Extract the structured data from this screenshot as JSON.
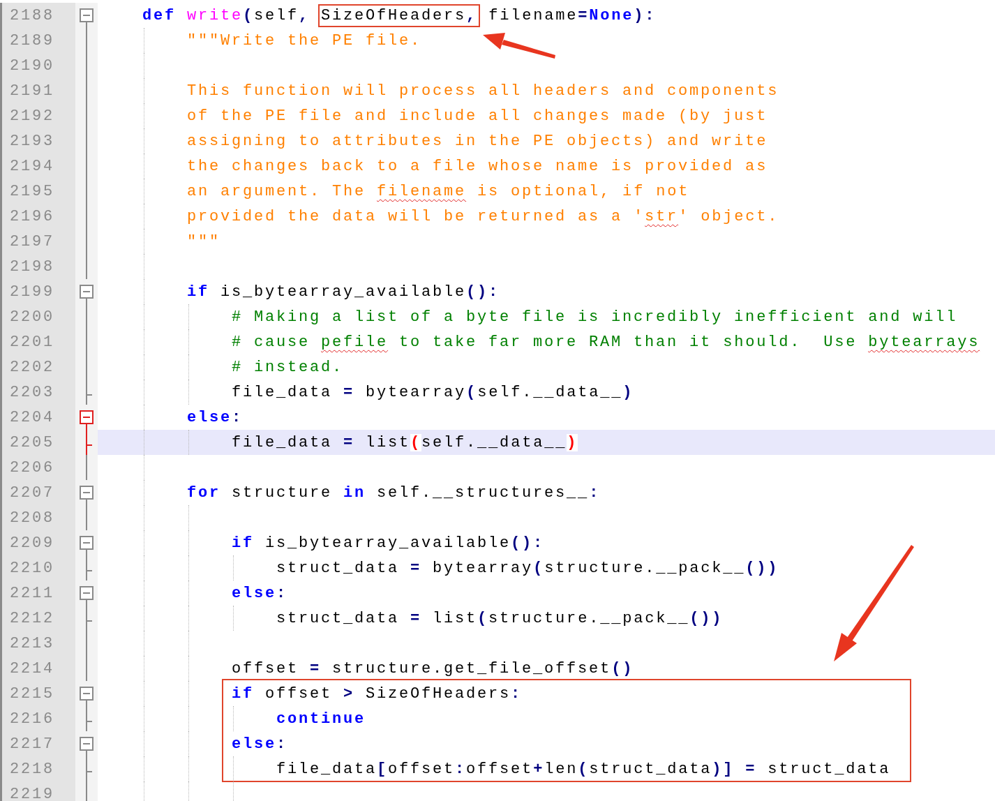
{
  "lines": [
    {
      "number": "2188",
      "kind": "open",
      "active": false,
      "current": false,
      "boxed": false,
      "tokens": [
        {
          "text": "    def",
          "kind": "kw"
        },
        {
          "text": " write",
          "kind": "fn"
        },
        {
          "text": "(",
          "kind": "op"
        },
        {
          "text": "self",
          "kind": "plain"
        },
        {
          "text": ", ",
          "kind": "op"
        },
        {
          "text": "SizeOfHeaders",
          "kind": "plain",
          "boxed": true
        },
        {
          "text": ",",
          "kind": "op",
          "boxed": true
        },
        {
          "text": " filename",
          "kind": "plain"
        },
        {
          "text": "=",
          "kind": "op"
        },
        {
          "text": "None",
          "kind": "kw"
        },
        {
          "text": ")",
          "kind": "op"
        },
        {
          "text": ":",
          "kind": "op"
        }
      ]
    },
    {
      "number": "2189",
      "kind": "line",
      "active": false,
      "current": false,
      "boxed": false,
      "tokens": [
        {
          "text": "        \"\"\"Write the PE file.",
          "kind": "doc"
        }
      ]
    },
    {
      "number": "2190",
      "kind": "line",
      "active": false,
      "current": false,
      "boxed": false
    },
    {
      "number": "2191",
      "kind": "line",
      "active": false,
      "current": false,
      "boxed": false,
      "tokens": [
        {
          "text": "        This function will process all headers and components",
          "kind": "doc"
        }
      ]
    },
    {
      "number": "2192",
      "kind": "line",
      "active": false,
      "current": false,
      "boxed": false,
      "tokens": [
        {
          "text": "        of the PE file and include all changes made (by just",
          "kind": "doc"
        }
      ]
    },
    {
      "number": "2193",
      "kind": "line",
      "active": false,
      "current": false,
      "boxed": false,
      "tokens": [
        {
          "text": "        assigning to attributes in the PE objects) and write",
          "kind": "doc"
        }
      ]
    },
    {
      "number": "2194",
      "kind": "line",
      "active": false,
      "current": false,
      "boxed": false,
      "tokens": [
        {
          "text": "        the changes back to a file whose name is provided as",
          "kind": "doc"
        }
      ]
    },
    {
      "number": "2195",
      "kind": "line",
      "active": false,
      "current": false,
      "boxed": false,
      "tokens": [
        {
          "text": "        an argument. The ",
          "kind": "doc"
        },
        {
          "text": "filename",
          "kind": "doc",
          "misspelled": true
        },
        {
          "text": " is optional, if not",
          "kind": "doc"
        }
      ]
    },
    {
      "number": "2196",
      "kind": "line",
      "active": false,
      "current": false,
      "boxed": false,
      "tokens": [
        {
          "text": "        provided the data will be returned as a '",
          "kind": "doc"
        },
        {
          "text": "str",
          "kind": "doc",
          "misspelled": true
        },
        {
          "text": "' object.",
          "kind": "doc"
        }
      ]
    },
    {
      "number": "2197",
      "kind": "line",
      "active": false,
      "current": false,
      "boxed": false,
      "tokens": [
        {
          "text": "        \"\"\"",
          "kind": "doc"
        }
      ]
    },
    {
      "number": "2198",
      "kind": "line",
      "active": false,
      "current": false,
      "boxed": false
    },
    {
      "number": "2199",
      "kind": "open",
      "active": false,
      "current": false,
      "boxed": false,
      "tokens": [
        {
          "text": "        if",
          "kind": "kw"
        },
        {
          "text": " is_bytearray_available",
          "kind": "plain"
        },
        {
          "text": "():",
          "kind": "op"
        }
      ]
    },
    {
      "number": "2200",
      "kind": "line",
      "active": false,
      "current": false,
      "boxed": false,
      "tokens": [
        {
          "text": "            # Making a list of a byte file is incredibly inefficient and will",
          "kind": "comment"
        }
      ]
    },
    {
      "number": "2201",
      "kind": "line",
      "active": false,
      "current": false,
      "boxed": false,
      "tokens": [
        {
          "text": "            # cause ",
          "kind": "comment"
        },
        {
          "text": "pefile",
          "kind": "comment",
          "misspelled": true
        },
        {
          "text": " to take far more RAM than it should.  Use ",
          "kind": "comment"
        },
        {
          "text": "bytearrays",
          "kind": "comment",
          "misspelled": true
        }
      ]
    },
    {
      "number": "2202",
      "kind": "line",
      "active": false,
      "current": false,
      "boxed": false,
      "tokens": [
        {
          "text": "            # instead.",
          "kind": "comment"
        }
      ]
    },
    {
      "number": "2203",
      "kind": "end",
      "active": false,
      "current": false,
      "boxed": false,
      "tokens": [
        {
          "text": "            file_data ",
          "kind": "plain"
        },
        {
          "text": "=",
          "kind": "op"
        },
        {
          "text": " bytearray",
          "kind": "plain"
        },
        {
          "text": "(",
          "kind": "op"
        },
        {
          "text": "self.__data__",
          "kind": "plain"
        },
        {
          "text": ")",
          "kind": "op"
        }
      ]
    },
    {
      "number": "2204",
      "kind": "open",
      "active": true,
      "current": false,
      "boxed": false,
      "tokens": [
        {
          "text": "        else",
          "kind": "kw"
        },
        {
          "text": ":",
          "kind": "op"
        }
      ]
    },
    {
      "number": "2205",
      "kind": "end",
      "active": true,
      "current": true,
      "boxed": false,
      "tokens": [
        {
          "text": "            file_data ",
          "kind": "plain"
        },
        {
          "text": "=",
          "kind": "op"
        },
        {
          "text": " list",
          "kind": "plain"
        },
        {
          "text": "(",
          "kind": "brace"
        },
        {
          "text": "self.__data__",
          "kind": "plain"
        },
        {
          "text": ")",
          "kind": "brace"
        }
      ]
    },
    {
      "number": "2206",
      "kind": "line",
      "active": false,
      "current": false,
      "boxed": false
    },
    {
      "number": "2207",
      "kind": "open",
      "active": false,
      "current": false,
      "boxed": false,
      "tokens": [
        {
          "text": "        for",
          "kind": "kw"
        },
        {
          "text": " structure ",
          "kind": "plain"
        },
        {
          "text": "in",
          "kind": "kw"
        },
        {
          "text": " self.__structures__",
          "kind": "plain"
        },
        {
          "text": ":",
          "kind": "op"
        }
      ]
    },
    {
      "number": "2208",
      "kind": "line",
      "active": false,
      "current": false,
      "boxed": false
    },
    {
      "number": "2209",
      "kind": "open",
      "active": false,
      "current": false,
      "boxed": false,
      "tokens": [
        {
          "text": "            if",
          "kind": "kw"
        },
        {
          "text": " is_bytearray_available",
          "kind": "plain"
        },
        {
          "text": "():",
          "kind": "op"
        }
      ]
    },
    {
      "number": "2210",
      "kind": "end",
      "active": false,
      "current": false,
      "boxed": false,
      "tokens": [
        {
          "text": "                struct_data ",
          "kind": "plain"
        },
        {
          "text": "=",
          "kind": "op"
        },
        {
          "text": " bytearray",
          "kind": "plain"
        },
        {
          "text": "(",
          "kind": "op"
        },
        {
          "text": "structure.__pack__",
          "kind": "plain"
        },
        {
          "text": "())",
          "kind": "op"
        }
      ]
    },
    {
      "number": "2211",
      "kind": "open",
      "active": false,
      "current": false,
      "boxed": false,
      "tokens": [
        {
          "text": "            else",
          "kind": "kw"
        },
        {
          "text": ":",
          "kind": "op"
        }
      ]
    },
    {
      "number": "2212",
      "kind": "end",
      "active": false,
      "current": false,
      "boxed": false,
      "tokens": [
        {
          "text": "                struct_data ",
          "kind": "plain"
        },
        {
          "text": "=",
          "kind": "op"
        },
        {
          "text": " list",
          "kind": "plain"
        },
        {
          "text": "(",
          "kind": "op"
        },
        {
          "text": "structure.__pack__",
          "kind": "plain"
        },
        {
          "text": "())",
          "kind": "op"
        }
      ]
    },
    {
      "number": "2213",
      "kind": "line",
      "active": false,
      "current": false,
      "boxed": false
    },
    {
      "number": "2214",
      "kind": "line",
      "active": false,
      "current": false,
      "boxed": false,
      "tokens": [
        {
          "text": "            offset ",
          "kind": "plain"
        },
        {
          "text": "=",
          "kind": "op"
        },
        {
          "text": " structure.get_file_offset",
          "kind": "plain"
        },
        {
          "text": "()",
          "kind": "op"
        }
      ]
    },
    {
      "number": "2215",
      "kind": "open",
      "active": false,
      "current": false,
      "boxed": true,
      "tokens": [
        {
          "text": "            if",
          "kind": "kw"
        },
        {
          "text": " offset ",
          "kind": "plain"
        },
        {
          "text": ">",
          "kind": "op"
        },
        {
          "text": " SizeOfHeaders",
          "kind": "plain"
        },
        {
          "text": ":",
          "kind": "op"
        }
      ]
    },
    {
      "number": "2216",
      "kind": "end",
      "active": false,
      "current": false,
      "boxed": true,
      "tokens": [
        {
          "text": "                continue",
          "kind": "kw"
        }
      ]
    },
    {
      "number": "2217",
      "kind": "open",
      "active": false,
      "current": false,
      "boxed": true,
      "tokens": [
        {
          "text": "            else",
          "kind": "kw"
        },
        {
          "text": ":",
          "kind": "op"
        }
      ]
    },
    {
      "number": "2218",
      "kind": "end",
      "active": false,
      "current": false,
      "boxed": true,
      "tokens": [
        {
          "text": "                file_data",
          "kind": "plain"
        },
        {
          "text": "[",
          "kind": "op"
        },
        {
          "text": "offset",
          "kind": "plain"
        },
        {
          "text": ":",
          "kind": "op"
        },
        {
          "text": "offset",
          "kind": "plain"
        },
        {
          "text": "+",
          "kind": "op"
        },
        {
          "text": "len",
          "kind": "plain"
        },
        {
          "text": "(",
          "kind": "op"
        },
        {
          "text": "struct_data",
          "kind": "plain"
        },
        {
          "text": ")]",
          "kind": "op"
        },
        {
          "text": " =",
          "kind": "op"
        },
        {
          "text": " struct_data",
          "kind": "plain"
        }
      ]
    },
    {
      "number": "2219",
      "kind": "line",
      "active": false,
      "current": false,
      "boxed": false
    }
  ]
}
